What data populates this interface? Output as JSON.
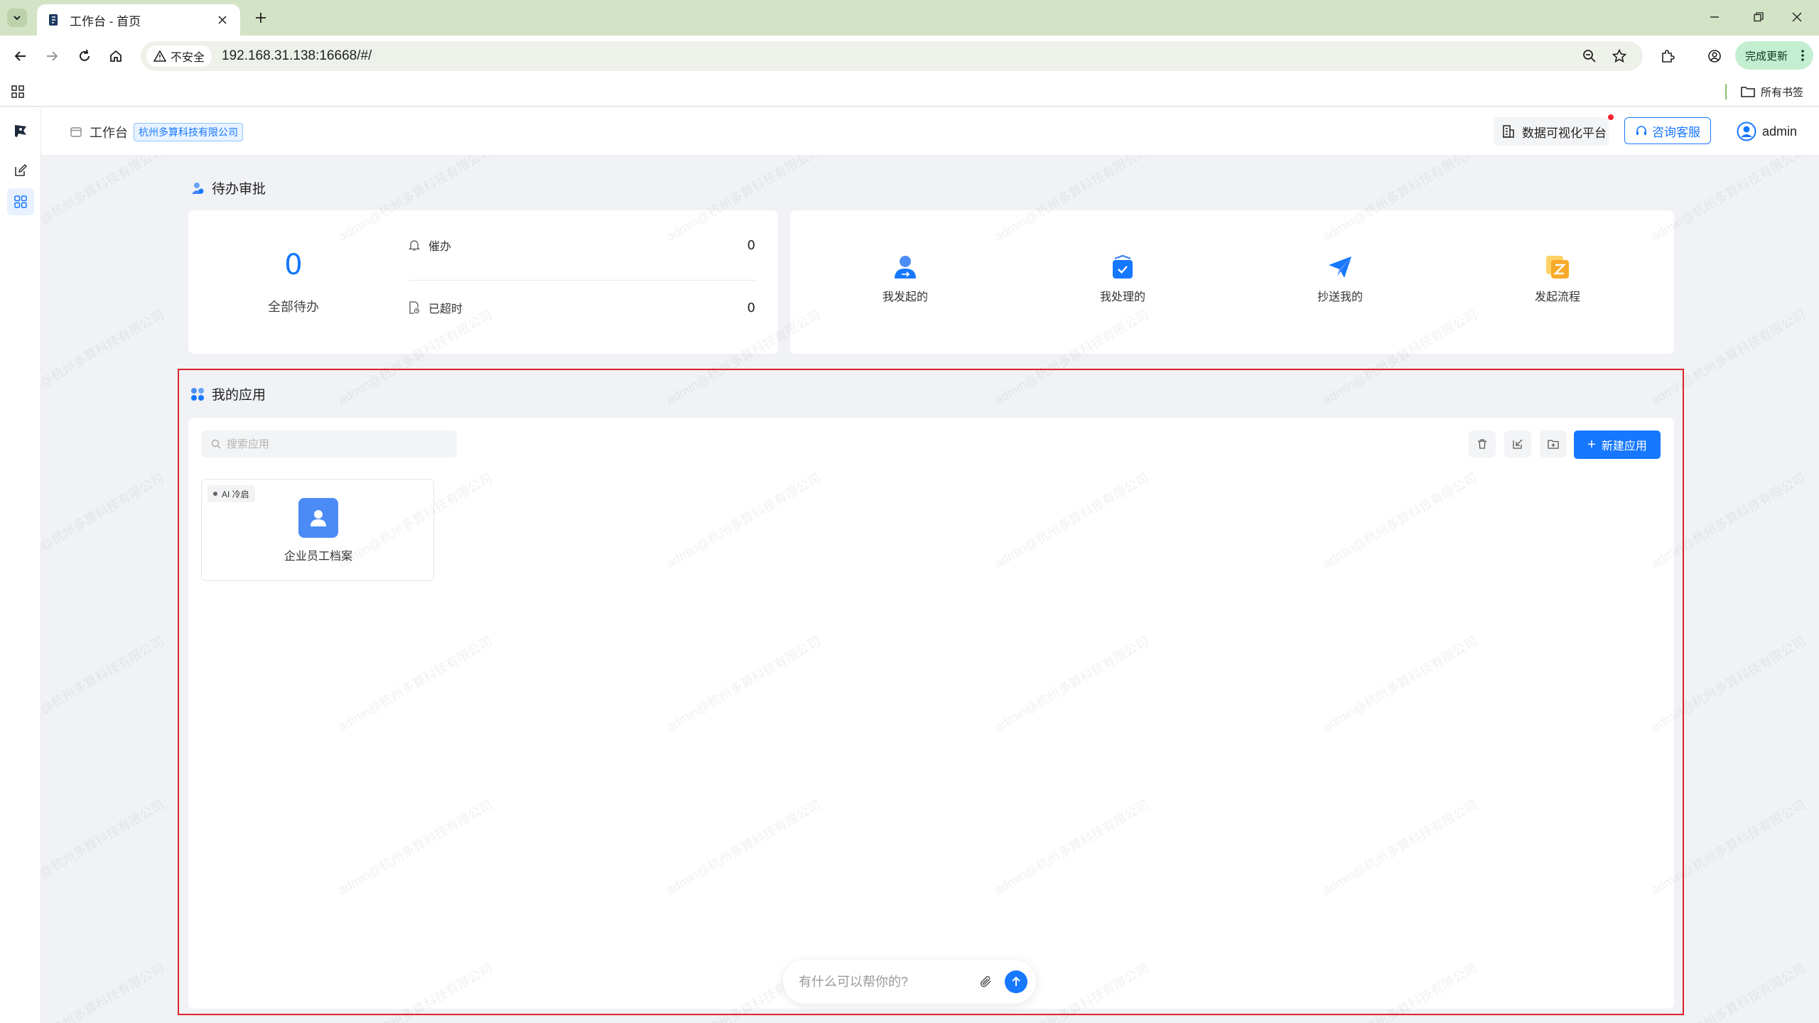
{
  "browser": {
    "tab_title": "工作台 - 首页",
    "insecure_label": "不安全",
    "url": "192.168.31.138:16668/#/",
    "update_label": "完成更新",
    "all_bookmarks": "所有书签"
  },
  "header": {
    "title": "工作台",
    "org": "杭州多算科技有限公司",
    "data_platform": "数据可视化平台",
    "consult": "咨询客服",
    "user": "admin"
  },
  "pending": {
    "section_title": "待办审批",
    "total": "0",
    "total_label": "全部待办",
    "urge_label": "催办",
    "urge_value": "0",
    "overdue_label": "已超时",
    "overdue_value": "0"
  },
  "quick_actions": [
    {
      "label": "我发起的",
      "icon": "user-send-icon"
    },
    {
      "label": "我处理的",
      "icon": "inbox-check-icon"
    },
    {
      "label": "抄送我的",
      "icon": "paper-plane-icon"
    },
    {
      "label": "发起流程",
      "icon": "start-flow-icon"
    }
  ],
  "apps": {
    "section_title": "我的应用",
    "search_placeholder": "搜索应用",
    "new_app": "新建应用",
    "items": [
      {
        "badge": "AI 冷启",
        "name": "企业员工档案"
      }
    ]
  },
  "chat": {
    "placeholder": "有什么可以帮你的?"
  },
  "watermark_text": "admin@杭州多算科技有限公司",
  "colors": {
    "primary": "#1677ff",
    "highlight_border": "#e0222a",
    "tabbar": "#d3e3c5"
  }
}
